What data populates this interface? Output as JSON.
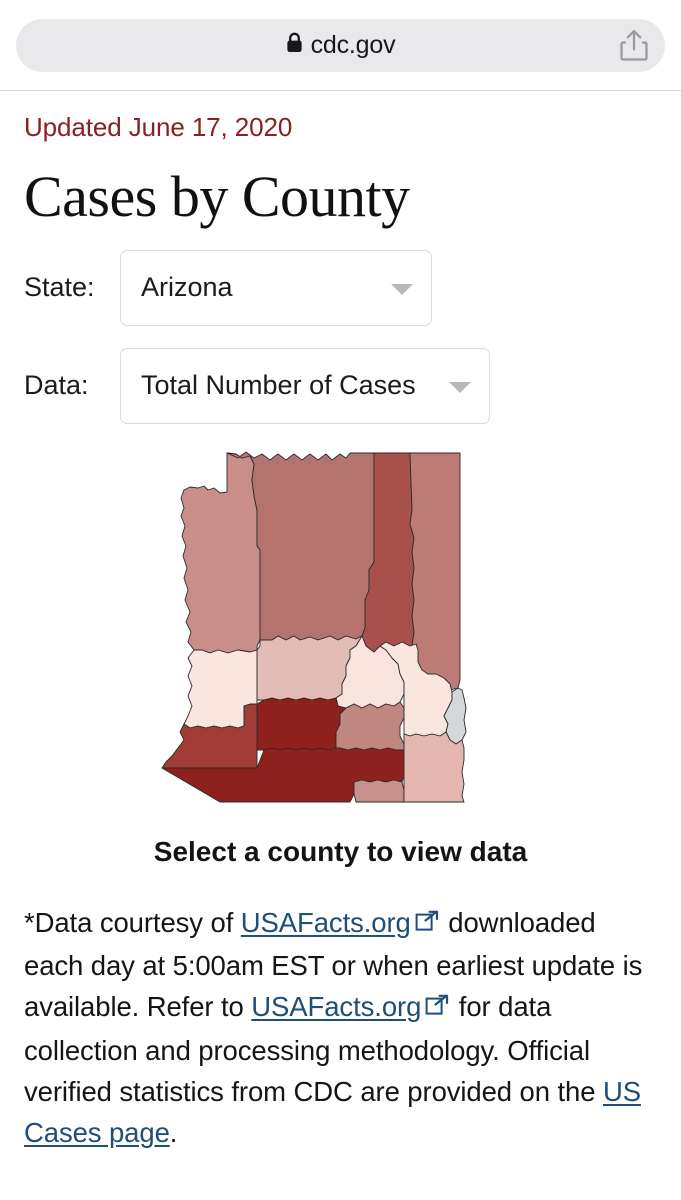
{
  "browser": {
    "url": "cdc.gov",
    "lock_icon": "lock-icon",
    "share_icon": "share-icon"
  },
  "page": {
    "updated": "Updated June 17, 2020",
    "title": "Cases by County",
    "map_caption": "Select a county to view data"
  },
  "controls": {
    "state": {
      "label": "State:",
      "value": "Arizona",
      "caret_icon": "chevron-down-icon"
    },
    "data": {
      "label": "Data:",
      "value": "Total Number of Cases",
      "caret_icon": "chevron-down-icon"
    }
  },
  "footnote": {
    "part1": "*Data courtesy of ",
    "link1": "USAFacts.org",
    "part2": " downloaded each day at 5:00am EST or when earliest update is available. Refer to ",
    "link2": "USAFacts.org",
    "part3": " for data collection and processing methodology. Official verified statistics from CDC are provided on the ",
    "link3": "US Cases page",
    "part4": "."
  },
  "chart_data": {
    "type": "map",
    "title": "Cases by County",
    "subtitle": "Arizona — Total Number of Cases",
    "region": "Arizona",
    "metric": "Total Number of Cases",
    "legend": "none",
    "color_scale": {
      "type": "sequential",
      "name": "Reds",
      "no_data_color": "#d5d7d9",
      "stops": [
        "#fae3da",
        "#f0ccc3",
        "#dfa9a2",
        "#cf918c",
        "#b9706c",
        "#a65a55",
        "#912a26",
        "#8e201d"
      ]
    },
    "counties": [
      {
        "name": "Mohave",
        "level": 4,
        "color": "#c98e88"
      },
      {
        "name": "Coconino",
        "level": 5,
        "color": "#b5736e"
      },
      {
        "name": "Navajo",
        "level": 6,
        "color": "#a8514c"
      },
      {
        "name": "Apache",
        "level": 5,
        "color": "#be7a74"
      },
      {
        "name": "Yavapai",
        "level": 3,
        "color": "#e2bdb6"
      },
      {
        "name": "Gila",
        "level": 1,
        "color": "#f8e4dc"
      },
      {
        "name": "La Paz",
        "level": 1,
        "color": "#f9e6de"
      },
      {
        "name": "Maricopa",
        "level": 8,
        "color": "#8e201d"
      },
      {
        "name": "Yuma",
        "level": 6,
        "color": "#a13c37"
      },
      {
        "name": "Pinal",
        "level": 4,
        "color": "#c08781"
      },
      {
        "name": "Graham",
        "level": 1,
        "color": "#f9e6de"
      },
      {
        "name": "Greenlee",
        "level": 0,
        "color": "#d5d7d9"
      },
      {
        "name": "Pima",
        "level": 8,
        "color": "#8e201d"
      },
      {
        "name": "Santa Cruz",
        "level": 4,
        "color": "#c8908a"
      },
      {
        "name": "Cochise",
        "level": 3,
        "color": "#e3b7b0"
      }
    ]
  }
}
